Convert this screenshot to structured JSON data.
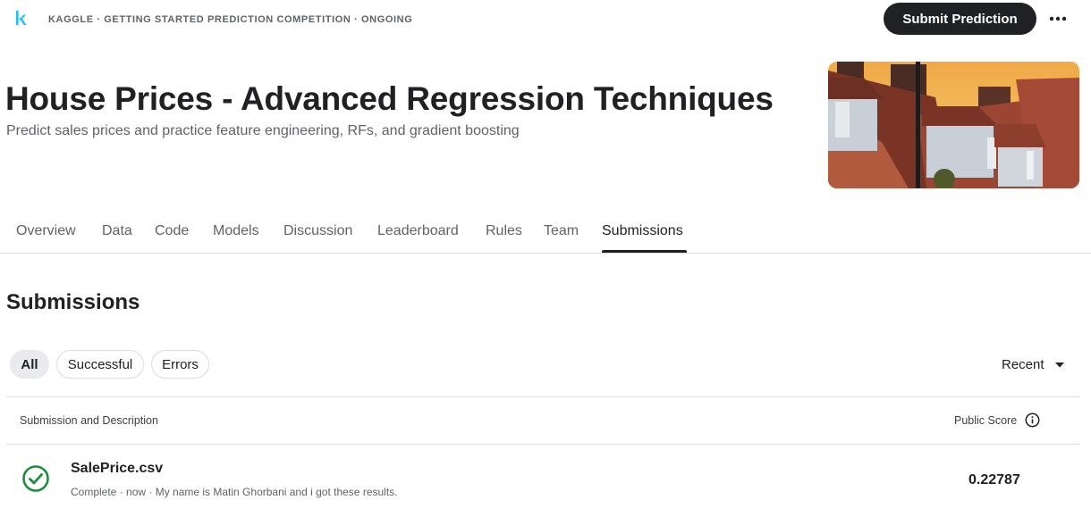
{
  "breadcrumb": "KAGGLE · GETTING STARTED PREDICTION COMPETITION · ONGOING",
  "logo_letter": "k",
  "buttons": {
    "submit_prediction": "Submit Prediction",
    "more": "•••"
  },
  "competition": {
    "title": "House Prices - Advanced Regression Techniques",
    "subtitle": "Predict sales prices and practice feature engineering, RFs, and gradient boosting"
  },
  "tabs": [
    {
      "label": "Overview"
    },
    {
      "label": "Data"
    },
    {
      "label": "Code"
    },
    {
      "label": "Models"
    },
    {
      "label": "Discussion"
    },
    {
      "label": "Leaderboard"
    },
    {
      "label": "Rules"
    },
    {
      "label": "Team"
    },
    {
      "label": "Submissions",
      "active": true
    }
  ],
  "submissions": {
    "heading": "Submissions",
    "filters": [
      "All",
      "Successful",
      "Errors"
    ],
    "active_filter": "All",
    "sort_label": "Recent",
    "columns": {
      "left": "Submission and Description",
      "right": "Public Score"
    },
    "rows": [
      {
        "file": "SalePrice.csv",
        "description": "Complete · now · My name is Matin Ghorbani and i got these results.",
        "status": "success",
        "public_score": "0.22787"
      }
    ]
  },
  "colors": {
    "accent": "#20beff",
    "success": "#1e8e3e",
    "primary_button": "#202124"
  },
  "icons": [
    "kaggle-logo",
    "more-icon",
    "chevron-down-icon",
    "info-icon",
    "check-circle-icon"
  ]
}
